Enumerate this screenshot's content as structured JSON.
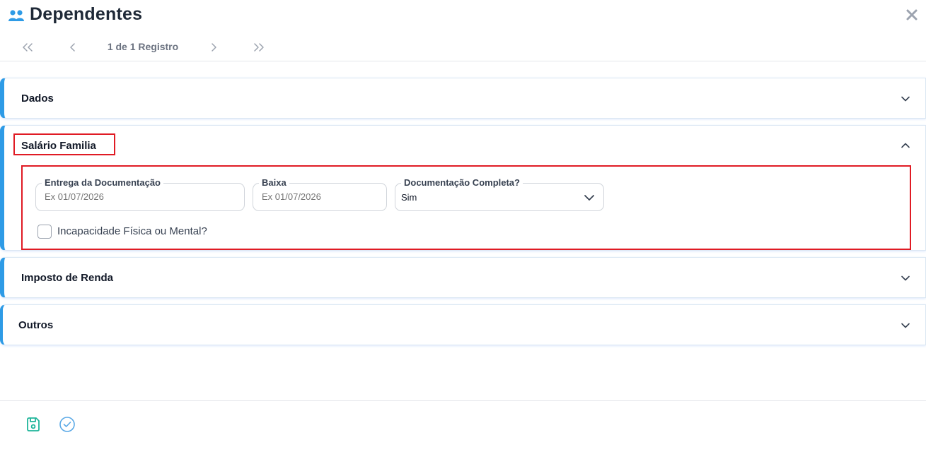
{
  "header": {
    "title": "Dependentes",
    "title_icon": "users-icon",
    "close_icon": "close-icon"
  },
  "pager": {
    "first_icon": "double-chevron-left-icon",
    "prev_icon": "chevron-left-icon",
    "text": "1 de 1 Registro",
    "next_icon": "chevron-right-icon",
    "last_icon": "double-chevron-right-icon"
  },
  "sections": [
    {
      "title": "Dados",
      "expanded": false
    },
    {
      "title": "Salário Familia",
      "expanded": true
    },
    {
      "title": "Imposto de Renda",
      "expanded": false
    },
    {
      "title": "Outros",
      "expanded": false
    }
  ],
  "salario_familia": {
    "entrega": {
      "label": "Entrega da Documentação",
      "placeholder": "Ex 01/07/2026"
    },
    "baixa": {
      "label": "Baixa",
      "placeholder": "Ex 01/07/2026"
    },
    "doc_completa": {
      "label": "Documentação Completa?",
      "value": "Sim"
    },
    "incapacidade": {
      "label": "Incapacidade Física ou Mental?",
      "checked": false
    }
  },
  "footer": {
    "save_icon": "save-icon",
    "confirm_icon": "check-circle-icon"
  },
  "colors": {
    "accent": "#2e9be6",
    "highlight": "#e01b24",
    "save_icon": "#1fb59a",
    "confirm_icon": "#5aa9e6"
  }
}
